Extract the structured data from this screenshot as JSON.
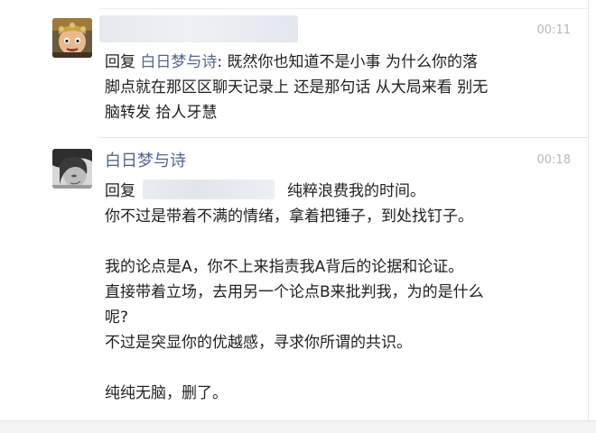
{
  "comments": [
    {
      "time": "00:11",
      "reply_prefix": "回复",
      "reply_to": "白日梦与诗",
      "colon": ":",
      "lines": [
        "既然你也知道不是小事 为什么你的落",
        "脚点就在那区区聊天记录上 还是那句话 从大局来看 别无",
        "脑转发 拾人牙慧"
      ]
    },
    {
      "author": "白日梦与诗",
      "time": "00:18",
      "reply_prefix": "回复",
      "reply_tail": "纯粹浪费我的时间。",
      "lines": [
        "你不过是带着不满的情绪，拿着把锤子，到处找钉子。",
        "",
        "我的论点是A，你不上来指责我A背后的论据和论证。",
        "直接带着立场，去用另一个论点B来批判我，为的是什么",
        "呢?",
        "不过是突显你的优越感，寻求你所谓的共识。",
        "",
        "纯纯无脑，删了。"
      ]
    }
  ],
  "colors": {
    "link": "#51678f",
    "text": "#1f1f1f",
    "time": "#b8b8b8"
  }
}
